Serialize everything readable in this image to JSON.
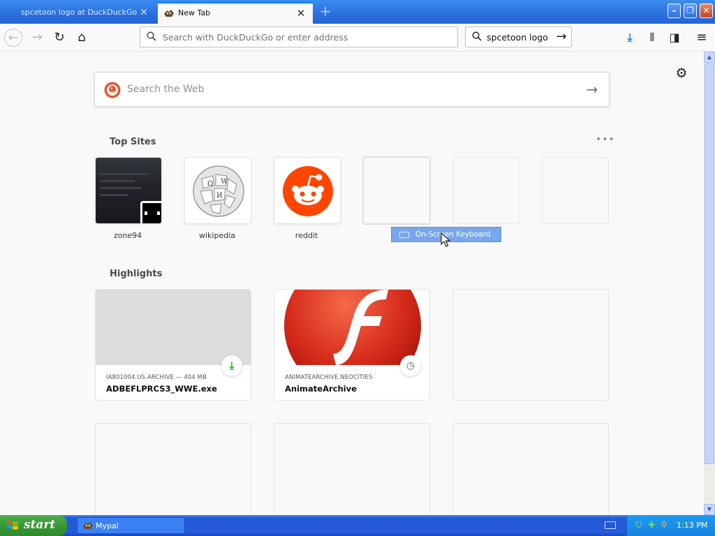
{
  "browser": {
    "tabs": [
      {
        "title": "spcetoon logo at DuckDuckGo",
        "active": false
      },
      {
        "title": "New Tab",
        "active": true
      }
    ],
    "url_placeholder": "Search with DuckDuckGo or enter address",
    "search_value": "spcetoon logo"
  },
  "page": {
    "web_search_placeholder": "Search the Web",
    "top_sites_title": "Top Sites",
    "top_sites": [
      {
        "label": "zone94"
      },
      {
        "label": "wikipedia"
      },
      {
        "label": "reddit"
      }
    ],
    "highlights_title": "Highlights",
    "highlights": [
      {
        "source": "IA801004.US.ARCHIVE — 404 MB",
        "title": "ADBEFLPRCS3_WWE.exe"
      },
      {
        "source": "ANIMATEARCHIVE.NEOCITIES",
        "title": "AnimateArchive"
      }
    ],
    "tooltip": "On-Screen Keyboard"
  },
  "taskbar": {
    "start_label": "start",
    "task_label": "Mypal",
    "time": "1:13 PM"
  },
  "colors": {
    "accent": "#0a84ff",
    "reddit": "#ff4500",
    "flash_red": "#d62b1b",
    "download_green": "#12bc00"
  },
  "icons": [
    "back-icon",
    "forward-icon",
    "reload-icon",
    "home-icon",
    "search-icon",
    "arrow-right-icon",
    "download-icon",
    "library-icon",
    "sidebar-icon",
    "menu-icon",
    "gear-icon",
    "more-icon",
    "clock-icon",
    "keyboard-icon",
    "windows-flag-icon"
  ]
}
